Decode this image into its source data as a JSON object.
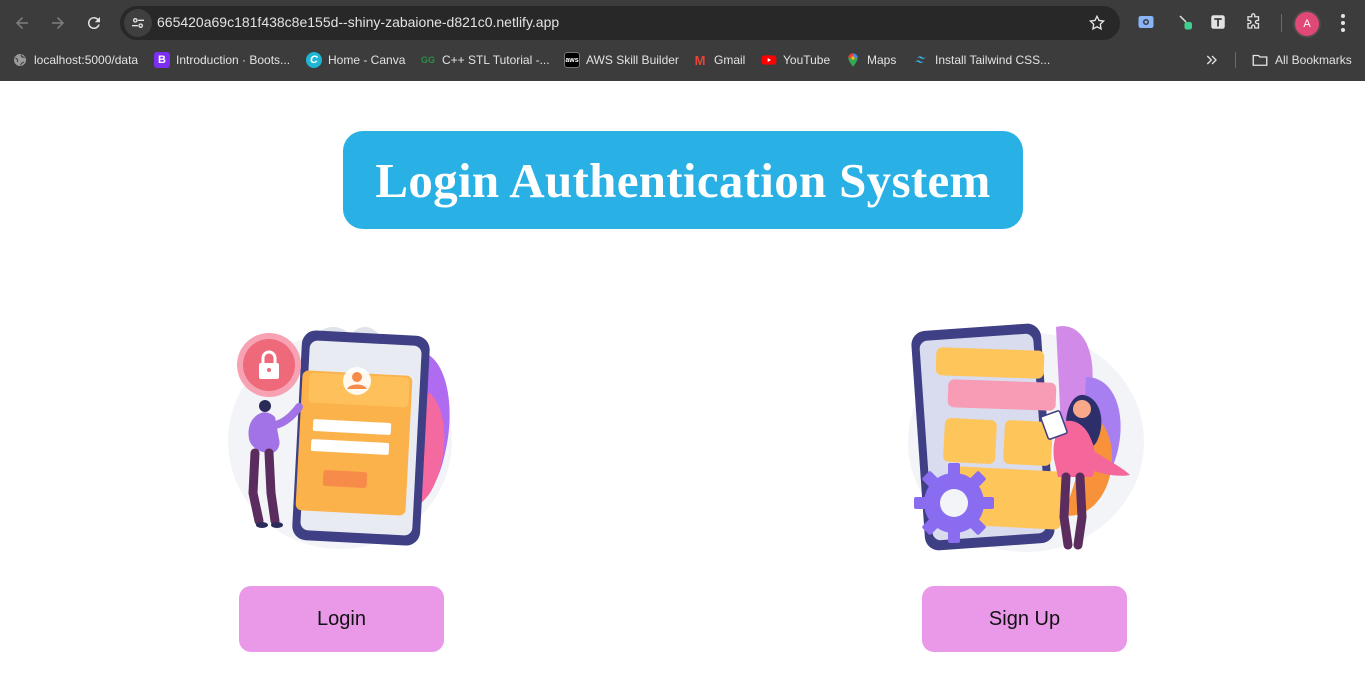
{
  "browser": {
    "url": "665420a69c181f438c8e155d--shiny-zabaione-d821c0.netlify.app",
    "profile_initial": "A",
    "bookmarks": [
      {
        "label": "localhost:5000/data",
        "icon": "globe-icon"
      },
      {
        "label": "Introduction · Boots...",
        "icon": "bootstrap-icon",
        "glyph": "B",
        "color": "#7b2ff2"
      },
      {
        "label": "Home - Canva",
        "icon": "canva-icon",
        "glyph": "C",
        "color": "#1fb6d6"
      },
      {
        "label": "C++ STL Tutorial -...",
        "icon": "gfg-icon",
        "glyph": "GG",
        "color": "#2f8d46"
      },
      {
        "label": "AWS Skill Builder",
        "icon": "aws-icon",
        "glyph": "aws",
        "color": "#000000"
      },
      {
        "label": "Gmail",
        "icon": "gmail-icon",
        "glyph": "M",
        "color": "#ea4335"
      },
      {
        "label": "YouTube",
        "icon": "youtube-icon",
        "color": "#ff0000"
      },
      {
        "label": "Maps",
        "icon": "maps-icon",
        "color": "#34a853"
      },
      {
        "label": "Install Tailwind CSS...",
        "icon": "tailwind-icon",
        "color": "#38bdf8"
      }
    ],
    "all_bookmarks_label": "All Bookmarks"
  },
  "page": {
    "title": "Login Authentication System",
    "login_label": "Login",
    "signup_label": "Sign Up"
  },
  "colors": {
    "title_bg": "#29b0e4",
    "button_bg": "#ea99e9"
  }
}
